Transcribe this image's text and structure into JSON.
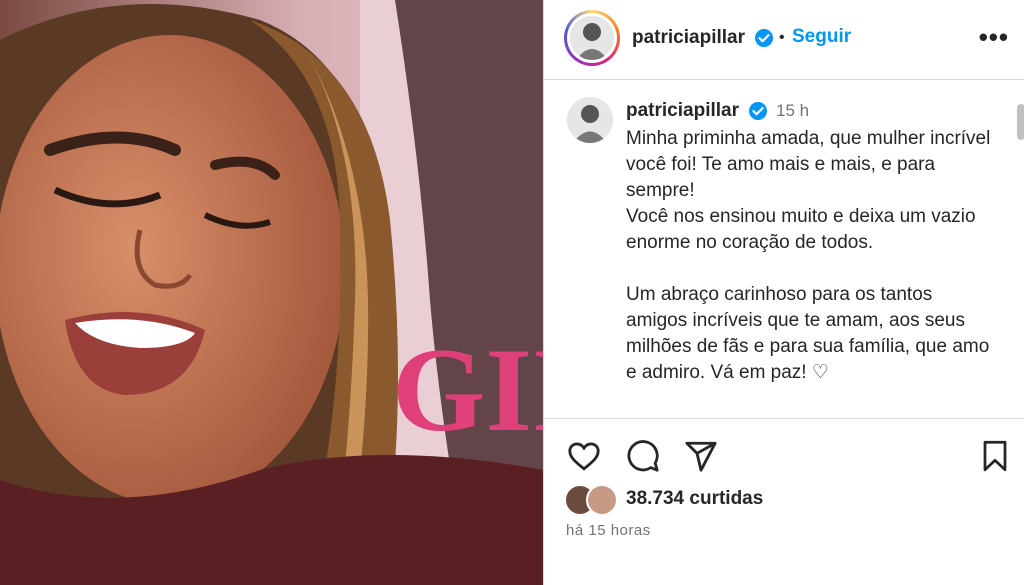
{
  "header": {
    "username": "patriciapillar",
    "separator": "•",
    "follow_label": "Seguir",
    "more_label": "•••"
  },
  "post": {
    "username": "patriciapillar",
    "time": "15 h",
    "caption": "Minha priminha amada, que mulher incrível você foi! Te amo mais e mais, e para sempre!\nVocê nos ensinou muito e deixa um vazio enorme no coração de todos.\n\nUm abraço carinhoso para os tantos amigos incríveis que te amam, aos seus milhões de fãs e para sua família, que amo e admiro. Vá em paz! ♡"
  },
  "stats": {
    "likes": "38.734 curtidas",
    "posted_ago": "há 15 horas"
  },
  "icons": {
    "verified": "verified-badge-icon",
    "like": "heart-icon",
    "comment": "comment-icon",
    "share": "paper-plane-icon",
    "save": "bookmark-icon"
  },
  "colors": {
    "link": "#0095f6",
    "verified": "#0095f6",
    "text": "#262626",
    "muted": "#737373",
    "border": "#dbdbdb"
  }
}
